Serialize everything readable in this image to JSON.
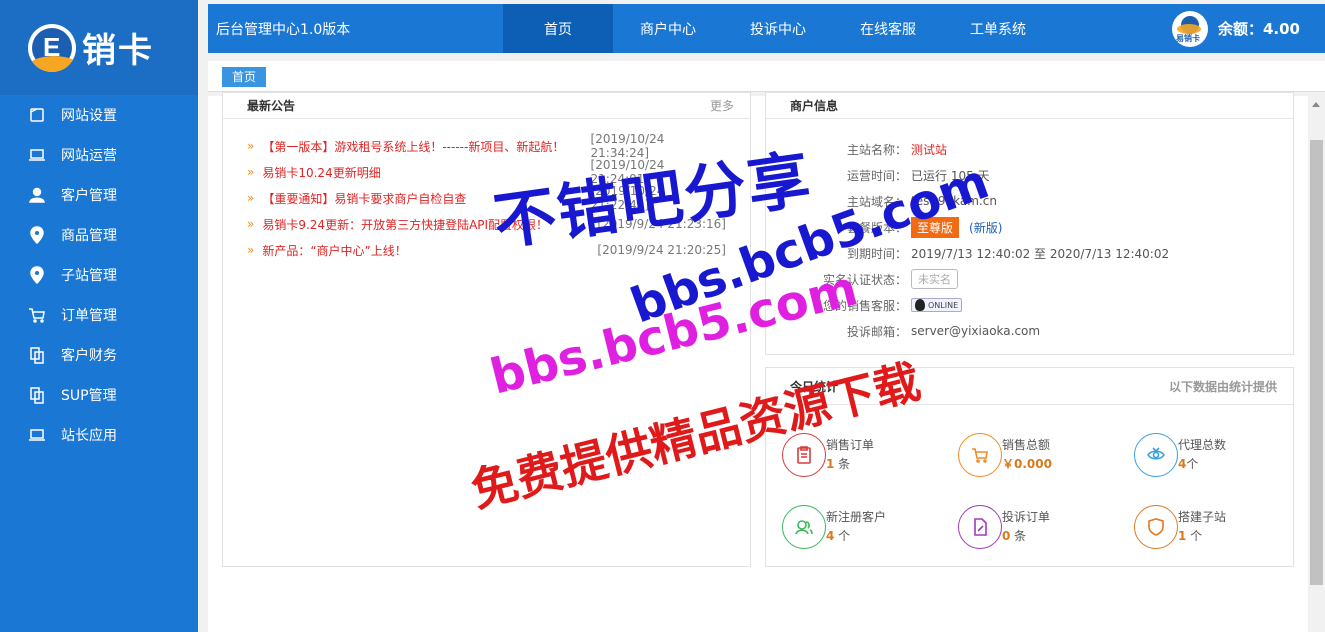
{
  "brand": {
    "logo_letter": "E",
    "logo_text": "销卡"
  },
  "sidebar": {
    "items": [
      {
        "label": "网站设置",
        "icon": "tablet-icon"
      },
      {
        "label": "网站运营",
        "icon": "laptop-icon"
      },
      {
        "label": "客户管理",
        "icon": "user-icon"
      },
      {
        "label": "商品管理",
        "icon": "location-pin-icon"
      },
      {
        "label": "子站管理",
        "icon": "location-pin-icon"
      },
      {
        "label": "订单管理",
        "icon": "cart-icon"
      },
      {
        "label": "客户财务",
        "icon": "copy-icon"
      },
      {
        "label": "SUP管理",
        "icon": "copy-icon"
      },
      {
        "label": "站长应用",
        "icon": "laptop-icon"
      }
    ]
  },
  "header": {
    "title": "后台管理中心1.0版本",
    "nav": [
      "首页",
      "商户中心",
      "投诉中心",
      "在线客服",
      "工单系统"
    ],
    "active_index": 0,
    "avatar_text": "易销卡",
    "balance": "余额：4.00"
  },
  "breadcrumb": {
    "label": "首页"
  },
  "announcements": {
    "title": "最新公告",
    "more": "更多",
    "items": [
      {
        "title": "【第一版本】游戏租号系统上线！------新项目、新起航！",
        "date": "[2019/10/24 21:34:24]"
      },
      {
        "title": "易销卡10.24更新明细",
        "date": "[2019/10/24 21:24:01]"
      },
      {
        "title": "【重要通知】易销卡要求商户自检自查",
        "date": "[2019/10/24 21:22:40]"
      },
      {
        "title": "易销卡9.24更新：开放第三方快捷登陆API配置权限！",
        "date": "[2019/9/24 21:23:16]"
      },
      {
        "title": "新产品：“商户中心”上线！",
        "date": "[2019/9/24 21:20:25]"
      }
    ]
  },
  "merchant": {
    "title": "商户信息",
    "rows": {
      "site_name_label": "主站名称：",
      "site_name": "测试站",
      "uptime_label": "运营时间：",
      "uptime": "已运行 105 天",
      "domain_label": "主站域名：",
      "domain": "test.95kam.cn",
      "plan_label": "套餐版本：",
      "plan": "至尊版",
      "plan_new": "(新版)",
      "expiry_label": "到期时间：",
      "expiry": "2019/7/13 12:40:02 至 2020/7/13 12:40:02",
      "auth_label": "实名认证状态：",
      "auth": "未实名",
      "sales_label": "您的销售客服：",
      "online": "ONLINE",
      "email_label": "投诉邮箱：",
      "email": "server@yixiaoka.com"
    }
  },
  "today": {
    "title": "今日统计",
    "note": "以下数据由统计提供",
    "stats": [
      {
        "label": "销售订单",
        "value": "1",
        "unit": " 条",
        "color": "#d93a3a",
        "icon": "clipboard-icon"
      },
      {
        "label": "销售总额",
        "value": "￥0.000",
        "unit": "",
        "color": "#f08a24",
        "icon": "cart-icon"
      },
      {
        "label": "代理总数",
        "value": "4",
        "unit": "个",
        "color": "#3aa0e0",
        "icon": "eye-icon"
      },
      {
        "label": "新注册客户",
        "value": "4",
        "unit": " 个",
        "color": "#3ab85a",
        "icon": "users-icon"
      },
      {
        "label": "投诉订单",
        "value": "0",
        "unit": " 条",
        "color": "#a03ab8",
        "icon": "document-edit-icon"
      },
      {
        "label": "搭建子站",
        "value": "1",
        "unit": " 个",
        "color": "#e07a24",
        "icon": "shield-icon"
      }
    ]
  },
  "watermark": {
    "line1": "不错吧分享",
    "line2": "bbs.bcb5.com",
    "line3": "bbs.bcb5.com",
    "line4": "免费提供精品资源下载"
  }
}
